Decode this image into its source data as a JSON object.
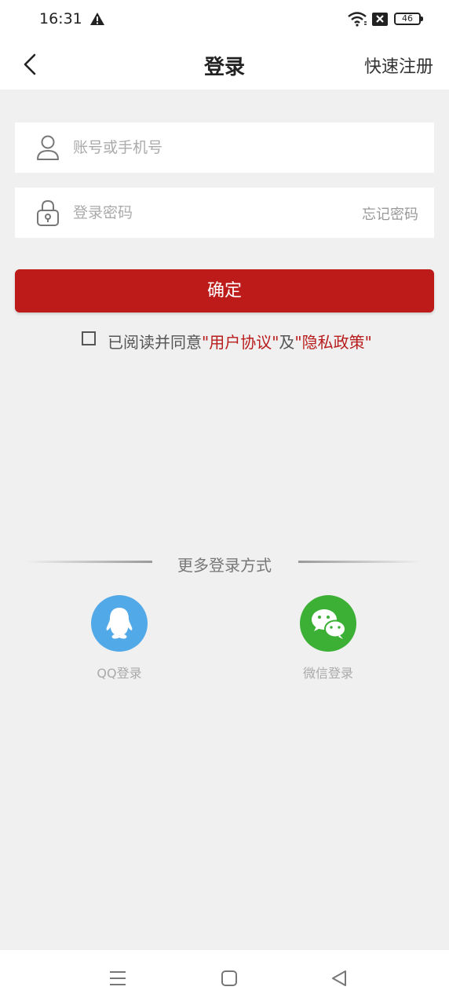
{
  "status_bar": {
    "time": "16:31",
    "battery": "46",
    "icons": [
      "warning-icon",
      "wifi-icon",
      "sim-off-icon",
      "battery-icon"
    ]
  },
  "header": {
    "title": "登录",
    "register_label": "快速注册",
    "back_icon": "chevron-left-icon"
  },
  "form": {
    "account_placeholder": "账号或手机号",
    "account_value": "",
    "password_placeholder": "登录密码",
    "password_value": "",
    "forgot_label": "忘记密码",
    "confirm_label": "确定"
  },
  "agreement": {
    "checked": false,
    "prefix": "已阅读并同意",
    "quote_open_1": "\"",
    "user_agreement": "用户协议",
    "quote_close_1": "\"",
    "conjunction": "及",
    "quote_open_2": "\"",
    "privacy_policy": "隐私政策",
    "quote_close_2": "\""
  },
  "more_login": {
    "title": "更多登录方式",
    "options": [
      {
        "label": "QQ登录",
        "icon": "qq-icon",
        "color": "#52a9e8"
      },
      {
        "label": "微信登录",
        "icon": "wechat-icon",
        "color": "#3cb035"
      }
    ]
  },
  "theme": {
    "accent": "#bd1a1a",
    "background": "#f0f0f0"
  },
  "system_nav": [
    "menu-icon",
    "home-icon",
    "back-triangle-icon"
  ]
}
